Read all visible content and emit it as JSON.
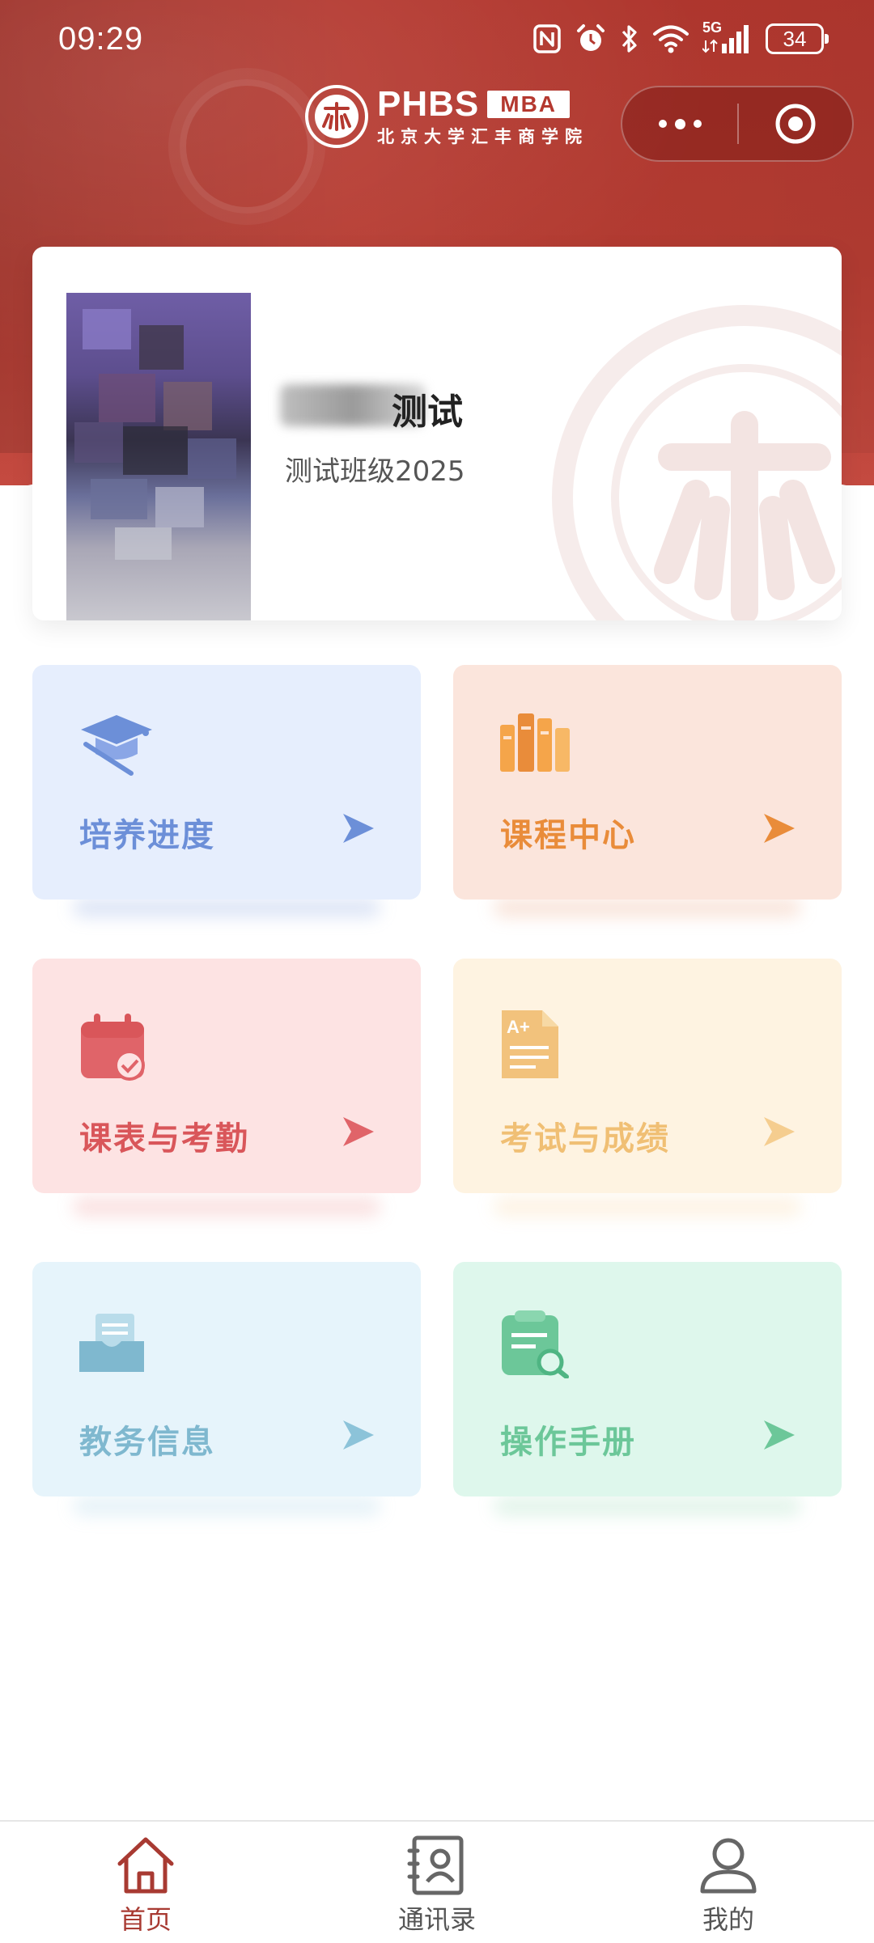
{
  "status_bar": {
    "time": "09:29",
    "network": "5G",
    "battery": "34"
  },
  "header": {
    "logo_brand": "PHBS",
    "logo_badge": "MBA",
    "logo_subtitle": "北京大学汇丰商学院"
  },
  "profile": {
    "name": "测试",
    "class": "测试班级2025"
  },
  "menu": [
    {
      "label": "培养进度",
      "icon": "graduation-cap-icon",
      "color": "#6c8fd8"
    },
    {
      "label": "课程中心",
      "icon": "books-icon",
      "color": "#e98c3a"
    },
    {
      "label": "课表与考勤",
      "icon": "calendar-check-icon",
      "color": "#d9565a"
    },
    {
      "label": "考试与成绩",
      "icon": "grade-document-icon",
      "color": "#f0bf74"
    },
    {
      "label": "教务信息",
      "icon": "inbox-document-icon",
      "color": "#7fb8cf"
    },
    {
      "label": "操作手册",
      "icon": "clipboard-search-icon",
      "color": "#6cc799"
    }
  ],
  "tabbar": {
    "items": [
      {
        "label": "首页",
        "icon": "home-icon",
        "active": true
      },
      {
        "label": "通讯录",
        "icon": "contacts-icon",
        "active": false
      },
      {
        "label": "我的",
        "icon": "profile-icon",
        "active": false
      }
    ],
    "active_color": "#a83a32"
  },
  "colors": {
    "brand_red": "#b4382f"
  }
}
